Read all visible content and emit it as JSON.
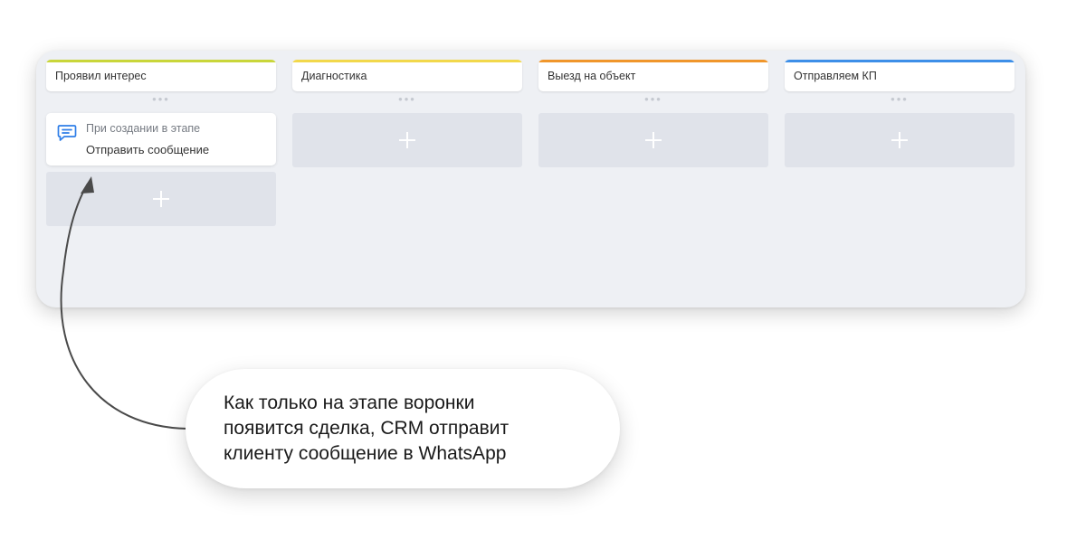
{
  "colors": {
    "board_background": "#eef0f4",
    "column_header_bars": [
      "#c9d63a",
      "#f2d84b",
      "#f0962b",
      "#3d8fe8"
    ],
    "message_icon": "#2f7ee8",
    "add_slot": "#e0e3ea"
  },
  "columns": [
    {
      "title": "Проявил интерес",
      "dots": "•••"
    },
    {
      "title": "Диагностика",
      "dots": "•••"
    },
    {
      "title": "Выезд на объект",
      "dots": "•••"
    },
    {
      "title": "Отправляем КП",
      "dots": "•••"
    }
  ],
  "trigger": {
    "icon": "message-icon",
    "when": "При создании в этапе",
    "action": "Отправить сообщение"
  },
  "add_icon": "plus-icon",
  "callout": {
    "lines": [
      "Как только на этапе воронки",
      "появится сделка, CRM отправит",
      "клиенту сообщение в WhatsApp"
    ]
  }
}
